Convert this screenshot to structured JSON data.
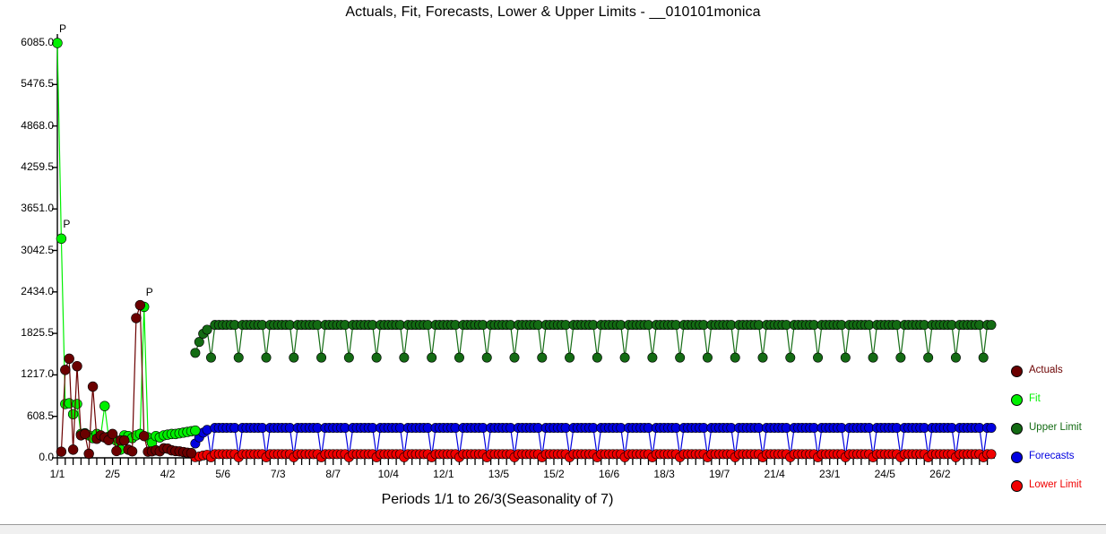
{
  "chart_data": {
    "type": "line",
    "title": "Actuals, Fit, Forecasts, Lower & Upper Limits - __010101monica",
    "xlabel": "Periods 1/1 to 26/3(Seasonality of 7)",
    "ylabel": "",
    "grid": false,
    "legend_position": "right",
    "ylim": [
      0,
      6085.0
    ],
    "ytick_labels": [
      "6085.0",
      "5476.5",
      "4868.0",
      "4259.5",
      "3651.0",
      "3042.5",
      "2434.0",
      "1825.5",
      "1217.0",
      "608.5",
      "0.0"
    ],
    "ytick_values": [
      6085.0,
      5476.5,
      4868.0,
      4259.5,
      3651.0,
      3042.5,
      2434.0,
      1825.5,
      1217.0,
      608.5,
      0.0
    ],
    "xtick_labels": [
      "1/1",
      "2/5",
      "4/2",
      "5/6",
      "7/3",
      "8/7",
      "10/4",
      "12/1",
      "13/5",
      "15/2",
      "16/6",
      "18/3",
      "19/7",
      "21/4",
      "23/1",
      "24/5",
      "26/2"
    ],
    "xtick_positions": [
      0,
      14,
      28,
      42,
      56,
      70,
      84,
      98,
      112,
      126,
      140,
      154,
      168,
      182,
      196,
      210,
      224
    ],
    "n_periods": 238,
    "seasonality": 7,
    "forecast_start_index": 35,
    "annotations": [
      {
        "label": "P",
        "x": 0,
        "y": 6085
      },
      {
        "label": "P",
        "x": 1,
        "y": 3215
      },
      {
        "label": "P",
        "x": 22,
        "y": 2215
      }
    ],
    "series": [
      {
        "name": "Actuals",
        "color": "#6b0000",
        "x": [
          1,
          2,
          3,
          4,
          5,
          6,
          7,
          8,
          9,
          10,
          11,
          12,
          13,
          14,
          15,
          16,
          17,
          18,
          19,
          20,
          21,
          22,
          23,
          24,
          25,
          26,
          27,
          28,
          29,
          30,
          31,
          32,
          33,
          34
        ],
        "values": [
          90,
          1290,
          1455,
          120,
          1345,
          330,
          350,
          60,
          1045,
          280,
          330,
          300,
          260,
          350,
          100,
          255,
          255,
          120,
          95,
          2050,
          2240,
          320,
          90,
          95,
          110,
          95,
          140,
          135,
          110,
          100,
          95,
          85,
          75,
          70
        ]
      },
      {
        "name": "Fit",
        "color": "#00f000",
        "x": [
          0,
          1,
          2,
          3,
          4,
          5,
          6,
          7,
          8,
          9,
          10,
          11,
          12,
          13,
          14,
          15,
          16,
          17,
          18,
          19,
          20,
          21,
          22,
          23,
          24,
          25,
          26,
          27,
          28,
          29,
          30,
          31,
          32,
          33,
          34,
          35
        ],
        "values": [
          6085,
          3215,
          790,
          800,
          640,
          790,
          350,
          360,
          330,
          290,
          350,
          320,
          760,
          310,
          300,
          250,
          120,
          330,
          320,
          290,
          330,
          350,
          2215,
          300,
          220,
          320,
          300,
          330,
          340,
          350,
          350,
          360,
          370,
          380,
          390,
          400
        ]
      },
      {
        "name": "Upper Limit",
        "color": "#136b13",
        "color_note": "dark green",
        "x_start": 35,
        "x_end": 237,
        "high_level": 1950,
        "dip_level": 1470,
        "dip_phase": 4,
        "ramp_in": [
          1540,
          1700,
          1820,
          1880
        ]
      },
      {
        "name": "Forecasts",
        "color": "#0000e0",
        "x_start": 35,
        "x_end": 237,
        "high_level": 440,
        "dip_level": 25,
        "dip_phase": 4,
        "ramp_in": [
          210,
          300,
          370,
          410
        ]
      },
      {
        "name": "Lower Limit",
        "color": "#f00000",
        "x_start": 35,
        "x_end": 237,
        "high_level": 55,
        "dip_level": 8,
        "dip_phase": 4,
        "ramp_in": [
          10,
          20,
          35,
          45
        ]
      }
    ]
  },
  "legend": {
    "items": [
      {
        "label": "Actuals",
        "color": "#6b0000"
      },
      {
        "label": "Fit",
        "color": "#00f000"
      },
      {
        "label": "Upper Limit",
        "color": "#136b13"
      },
      {
        "label": "Forecasts",
        "color": "#0000e0"
      },
      {
        "label": "Lower Limit",
        "color": "#f00000"
      }
    ]
  }
}
